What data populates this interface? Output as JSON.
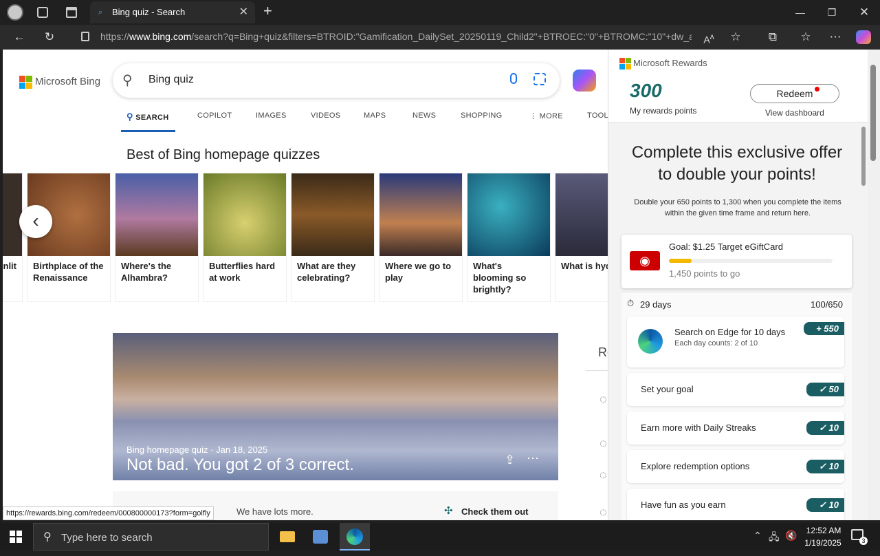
{
  "browser": {
    "tab_title": "Bing quiz - Search",
    "url_prefix": "https://",
    "url_domain": "www.bing.com",
    "url_rest": "/search?q=Bing+quiz&filters=BTROID:\"Gamification_DailySet_20250119_Child2\"+BTROEC:\"0\"+BTROMC:\"10\"+dw_a..."
  },
  "bing": {
    "logo_text": "Microsoft Bing",
    "search_value": "Bing quiz",
    "tabs": [
      "SEARCH",
      "COPILOT",
      "IMAGES",
      "VIDEOS",
      "MAPS",
      "NEWS",
      "SHOPPING",
      "MORE",
      "TOOLS"
    ],
    "section_title": "Best of Bing homepage quizzes",
    "quiz_cards": [
      {
        "caption": "nlit",
        "color": "#3a2e28"
      },
      {
        "caption": "Birthplace of the Renaissance",
        "color": "#8a4f2e"
      },
      {
        "caption": "Where's the Alhambra?",
        "color": "#5a4a7a"
      },
      {
        "caption": "Butterflies hard at work",
        "color": "#7a8a3a"
      },
      {
        "caption": "What are they celebrating?",
        "color": "#6a4a1a"
      },
      {
        "caption": "Where we go to play",
        "color": "#3a4a7a"
      },
      {
        "caption": "What's blooming so brightly?",
        "color": "#1a6a7a"
      },
      {
        "caption": "What is hydrometeo",
        "color": "#4a4a6a"
      }
    ],
    "hero": {
      "subtitle": "Bing homepage quiz · Jan 18, 2025",
      "title": "Not bad. You got 2 of 3 correct."
    },
    "more_text": "We have lots more.",
    "check_text": "Check them out",
    "right_letter": "Re",
    "status_url": "https://rewards.bing.com/redeem/000800000173?form=golfly"
  },
  "rewards": {
    "brand": "Microsoft Rewards",
    "points": "300",
    "points_label": "My rewards points",
    "redeem_label": "Redeem",
    "dashboard_label": "View dashboard",
    "offer_title": "Complete this exclusive offer to double your points!",
    "offer_desc": "Double your 650 points to 1,300 when you complete the items within the given time frame and return here.",
    "goal_title": "Goal: $1.25 Target eGiftCard",
    "goal_progress": 0.14,
    "goal_remaining": "1,450 points to go",
    "days_left": "29 days",
    "progress_count": "100/650",
    "tasks": [
      {
        "title": "Search on Edge for 10 days",
        "sub": "Each day counts: 2 of 10",
        "points": "+ 550"
      },
      {
        "title": "Set your goal",
        "points": "50"
      },
      {
        "title": "Earn more with Daily Streaks",
        "points": "10"
      },
      {
        "title": "Explore redemption options",
        "points": "10"
      },
      {
        "title": "Have fun as you earn",
        "points": "10"
      }
    ]
  },
  "taskbar": {
    "search_placeholder": "Type here to search",
    "time": "12:52 AM",
    "date": "1/19/2025",
    "notif_count": "3"
  }
}
